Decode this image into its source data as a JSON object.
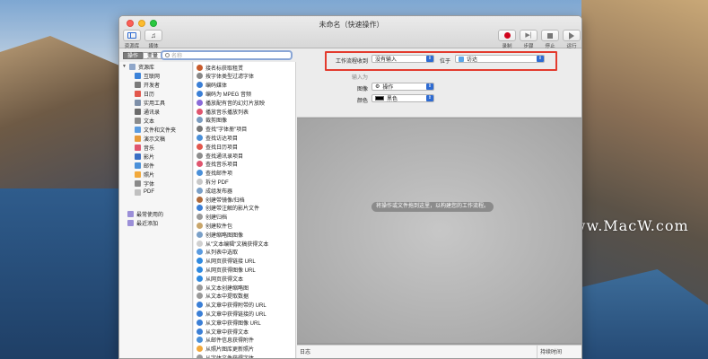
{
  "window": {
    "title": "未命名（快速操作）"
  },
  "toolbar": {
    "library_label": "资源库",
    "media_label": "媒体",
    "record_label": "录制",
    "step_label": "步骤",
    "stop_label": "停止",
    "run_label": "运行"
  },
  "tabs": {
    "actions": "操作",
    "variables": "变量"
  },
  "search": {
    "placeholder": "名称"
  },
  "library": {
    "root": "资源库",
    "items": [
      "互联网",
      "开发者",
      "日历",
      "实用工具",
      "通讯录",
      "文本",
      "文件和文件夹",
      "演示文稿",
      "音乐",
      "影片",
      "邮件",
      "照片",
      "字体",
      "PDF"
    ],
    "recent_used": "最常使用的",
    "recent_added": "最近添加"
  },
  "actions": [
    "接名标获取租赁",
    "按字体类型过滤字体",
    "编码媒体",
    "编码为 MPEG 音频",
    "播放配有音的幻灯片放映",
    "播放音乐播放列表",
    "裁剪图像",
    "查找\"字体册\"项目",
    "查找访达项目",
    "查找日历项目",
    "查找通讯录项目",
    "查找音乐项目",
    "查找邮件项",
    "拆分 PDF",
    "成组发布器",
    "创建带镜像/归档",
    "创建带注解的影片文件",
    "创建归档",
    "创建软件包",
    "创建缩略图图像",
    "从\"文本编辑\"文稿获得文本",
    "从列表中选取",
    "从网页获得链接 URL",
    "从网页获得图像 URL",
    "从网页获得文本",
    "从文本创建缩略图",
    "从文本中提取数据",
    "从文章中获得附带的 URL",
    "从文章中获得链接的 URL",
    "从文章中获得图像 URL",
    "从文章中获得文本",
    "从邮件信息获得附件",
    "从照片图库更新照片",
    "从字体文件获得字体"
  ],
  "workflow": {
    "receives_label": "工作流程收到",
    "receives_value": "没有输入",
    "in_label": "位于",
    "in_value": "访达",
    "input_label": "输入为",
    "image_label": "图像",
    "image_value": "操作",
    "color_label": "颜色",
    "color_value": "黑色",
    "drop_hint": "将操作或文件拖到这里，以构建您的工作流程。"
  },
  "log": {
    "log_label": "日志",
    "duration_label": "持续时间"
  },
  "watermark": {
    "text": "www.MacW.com"
  },
  "colors": {
    "highlight": "#e33b2e",
    "accent": "#2e6bd2",
    "record": "#d0021b"
  }
}
